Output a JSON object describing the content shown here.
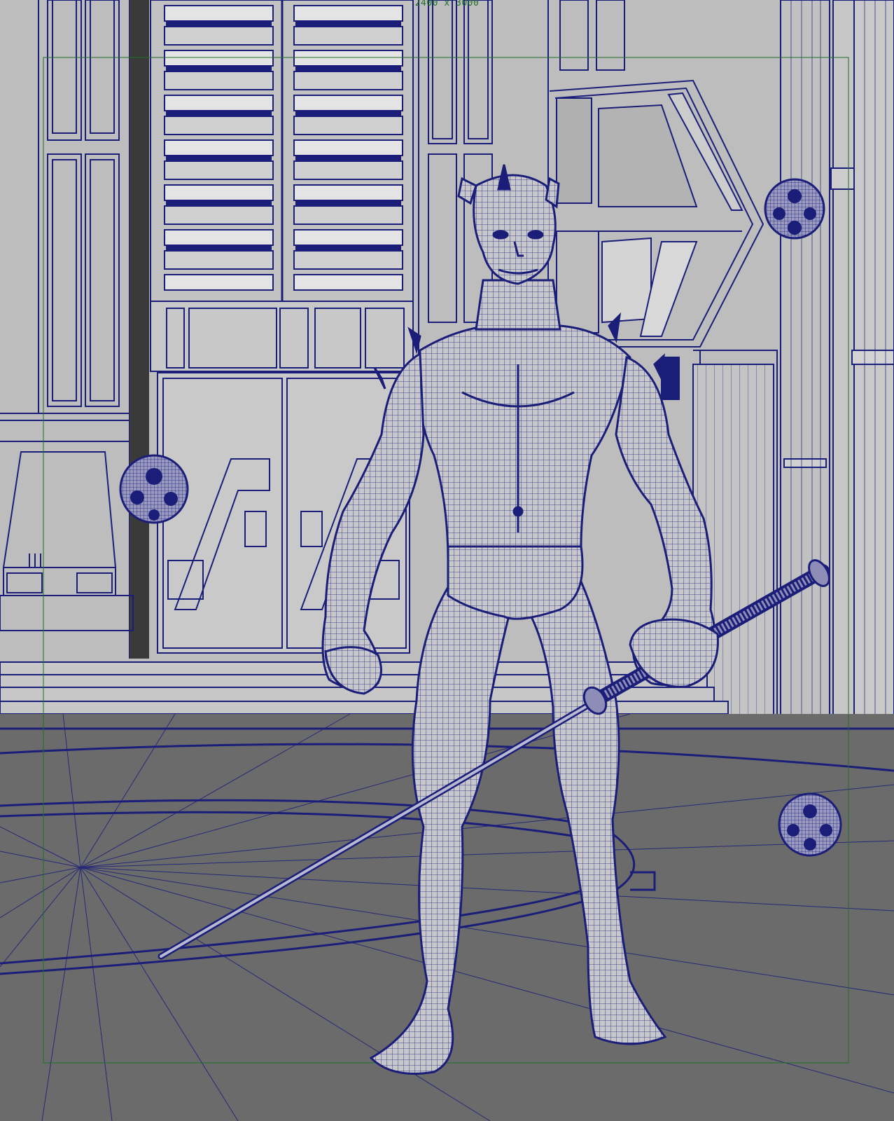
{
  "viewport": {
    "resolution_gate_label": "2400 x 3000",
    "background_color": "#6b6b6b",
    "wall_color": "#bdbdbd",
    "wireframe_color": "#1b1e78",
    "gate_color": "#1f6f2a"
  },
  "scene_objects": [
    {
      "name": "character",
      "icon": "humanoid-wireframe-icon"
    },
    {
      "name": "staff",
      "icon": "staff-wireframe-icon"
    },
    {
      "name": "droid-sphere-left",
      "icon": "sphere-wireframe-icon"
    },
    {
      "name": "droid-sphere-right-top",
      "icon": "sphere-wireframe-icon"
    },
    {
      "name": "droid-sphere-right-bottom",
      "icon": "sphere-wireframe-icon"
    }
  ]
}
